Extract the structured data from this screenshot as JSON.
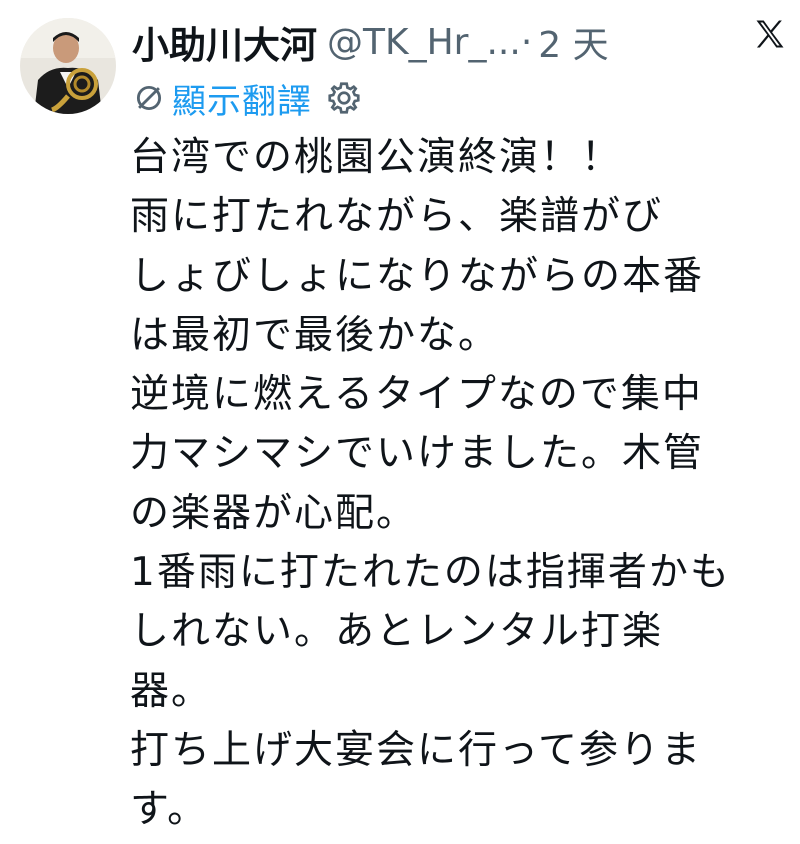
{
  "author": {
    "display_name": "小助川大河",
    "handle": "@TK_Hr_...",
    "separator": "·",
    "time": "2 天"
  },
  "translate": {
    "label": "顯示翻譯"
  },
  "tweet": {
    "lines": [
      "台湾での桃園公演終演！！",
      "雨に打たれながら、楽譜がび",
      "しょびしょになりながらの本番",
      "は最初で最後かな。",
      "逆境に燃えるタイプなので集中",
      "力マシマシでいけました。木管",
      "の楽器が心配。",
      "1番雨に打たれたのは指揮者かも",
      "しれない。あとレンタル打楽",
      "器。",
      "打ち上げ大宴会に行って参りま",
      "す。"
    ]
  },
  "icons": {
    "avatar": "user-avatar",
    "brand": "x-logo-icon",
    "translate": "translate-icon",
    "settings": "gear-icon"
  },
  "colors": {
    "text": "#0f1419",
    "secondary": "#536471",
    "link": "#1d9bf0"
  }
}
